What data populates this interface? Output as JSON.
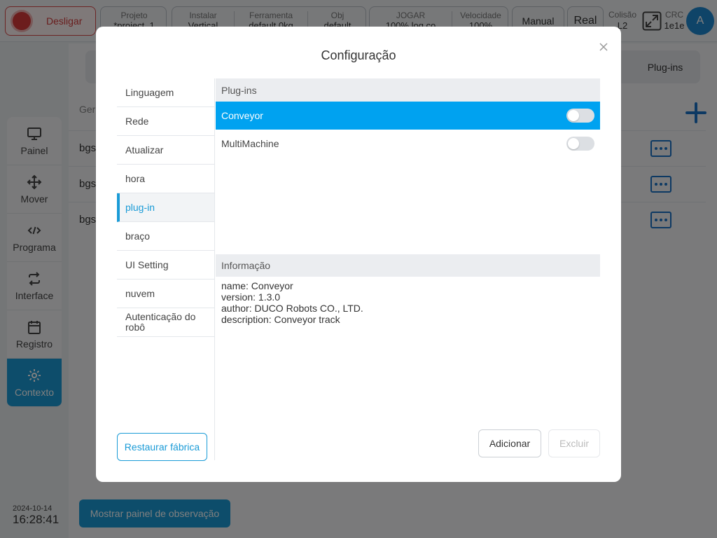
{
  "topbar": {
    "power_label": "Desligar",
    "project": {
      "label": "Projeto",
      "value": "*project_1"
    },
    "install": {
      "label": "Instalar",
      "value": "Vertical"
    },
    "tool": {
      "label": "Ferramenta",
      "value": "default    0kg"
    },
    "obj": {
      "label": "Obj",
      "value": "default"
    },
    "jog": {
      "label": "JOGAR",
      "value": "100%    log co"
    },
    "speed": {
      "label": "Velocidade",
      "value": "100%"
    },
    "manual_label": "Manual",
    "real_label": "Real",
    "collision": {
      "label": "Colisão",
      "value": "L2"
    },
    "crc": {
      "label": "CRC",
      "value": "1e1e"
    },
    "avatar_letter": "A"
  },
  "sidebar": {
    "items": [
      {
        "label": "Painel",
        "icon": "monitor-icon"
      },
      {
        "label": "Mover",
        "icon": "move-icon"
      },
      {
        "label": "Programa",
        "icon": "code-icon"
      },
      {
        "label": "Interface",
        "icon": "swap-icon"
      },
      {
        "label": "Registro",
        "icon": "calendar-icon"
      },
      {
        "label": "Contexto",
        "icon": "gear-icon",
        "active": true
      }
    ],
    "date": "2024-10-14",
    "time": "16:28:41"
  },
  "background": {
    "tab_plugins": "Plug-ins",
    "header": "Ger",
    "rows": [
      "bgs",
      "bgs",
      "bgs"
    ],
    "observe_button": "Mostrar painel de observação"
  },
  "modal": {
    "title": "Configuração",
    "nav": [
      {
        "label": "Linguagem"
      },
      {
        "label": "Rede"
      },
      {
        "label": "Atualizar"
      },
      {
        "label": "hora"
      },
      {
        "label": "plug-in",
        "active": true
      },
      {
        "label": "braço"
      },
      {
        "label": "UI Setting"
      },
      {
        "label": "nuvem"
      },
      {
        "label": "Autenticação do robô"
      }
    ],
    "restore_button": "Restaurar fábrica",
    "plugins_header": "Plug-ins",
    "plugins": [
      {
        "name": "Conveyor",
        "selected": true,
        "enabled": false
      },
      {
        "name": "MultiMachine",
        "selected": false,
        "enabled": false
      }
    ],
    "info_header": "Informação",
    "info_lines": [
      "name: Conveyor",
      "version: 1.3.0",
      "author: DUCO Robots CO., LTD.",
      "description: Conveyor track"
    ],
    "add_button": "Adicionar",
    "delete_button": "Excluir"
  },
  "colors": {
    "accent": "#1a9bd7",
    "selected_row": "#00a2f0",
    "power": "#d83a3a"
  }
}
